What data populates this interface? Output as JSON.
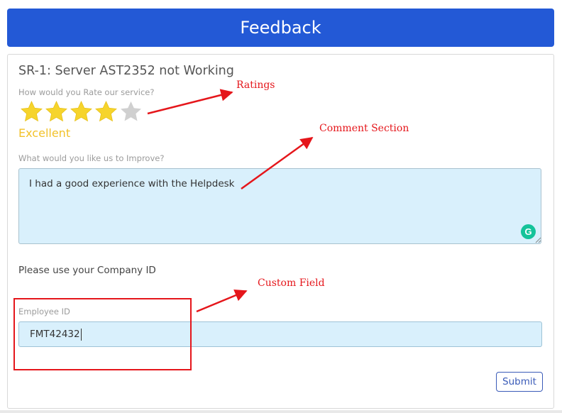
{
  "header": {
    "title": "Feedback"
  },
  "feedback": {
    "title": "SR-1: Server AST2352 not Working",
    "rating_question": "How would you Rate our service?",
    "rating": {
      "value": 4,
      "max": 5,
      "label": "Excellent"
    },
    "improve_question": "What would you like us to Improve?",
    "comment_value": "I had a good experience with the Helpdesk",
    "company_note": "Please use your Company ID",
    "employee_id_label": "Employee ID",
    "employee_id_value": "FMT42432",
    "submit_label": "Submit"
  },
  "annotations": {
    "ratings": "Ratings",
    "comment_section": "Comment Section",
    "custom_field": "Custom Field"
  },
  "colors": {
    "header_bg": "#2359d6",
    "star_filled": "#f6d42c",
    "star_empty": "#d0d0d0",
    "rating_text": "#f2c22b",
    "input_bg": "#d9f0fc",
    "annotation_red": "#e5161b",
    "submit_border": "#3a5bb8"
  },
  "icons": {
    "star": "star-icon",
    "grammarly": "grammarly-icon",
    "resize": "resize-handle-icon"
  }
}
